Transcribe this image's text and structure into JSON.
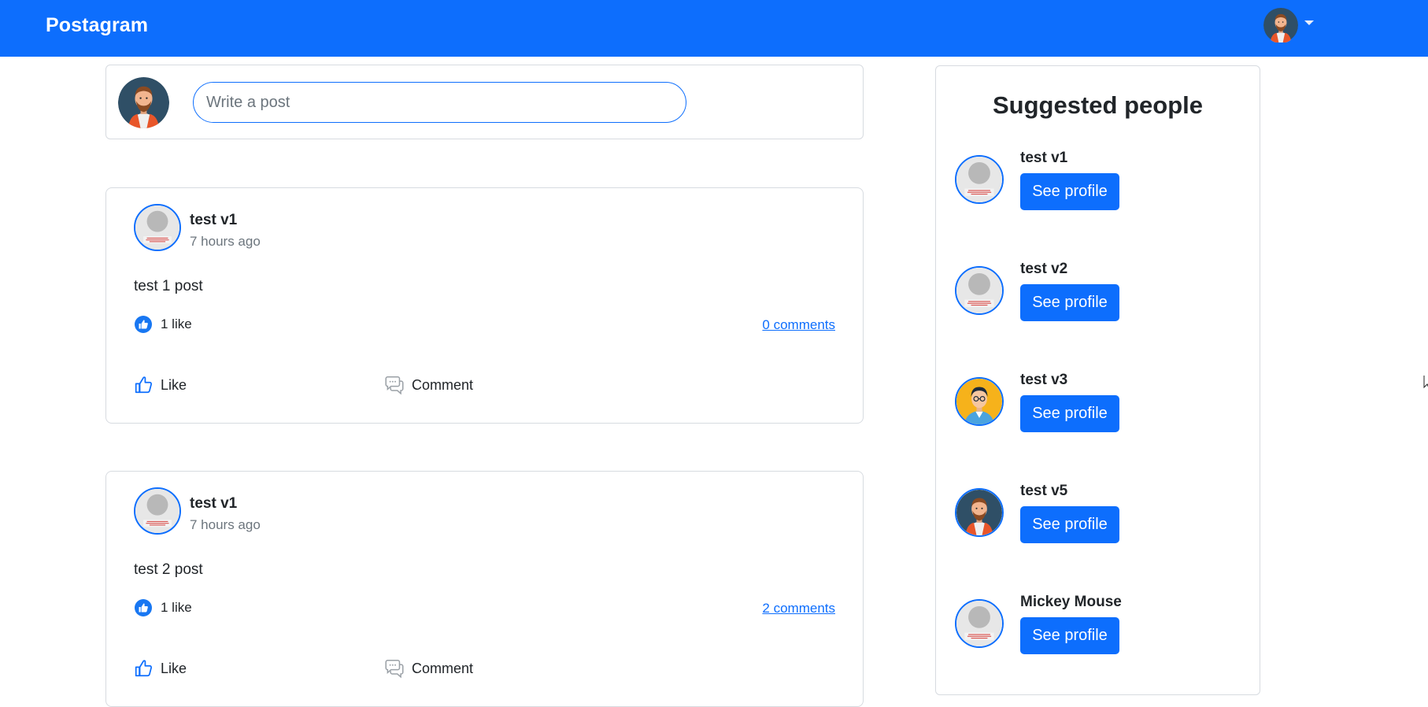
{
  "navbar": {
    "brand": "Postagram"
  },
  "composer": {
    "placeholder": "Write a post"
  },
  "posts": [
    {
      "author": "test v1",
      "time": "7 hours ago",
      "body": "test 1 post",
      "likes": "1 like",
      "comments": "0 comments",
      "like_label": "Like",
      "comment_label": "Comment"
    },
    {
      "author": "test v1",
      "time": "7 hours ago",
      "body": "test 2 post",
      "likes": "1 like",
      "comments": "2 comments",
      "like_label": "Like",
      "comment_label": "Comment"
    }
  ],
  "sidebar": {
    "title": "Suggested people",
    "people": [
      {
        "name": "test v1",
        "button": "See profile",
        "avatar": "default-avatar"
      },
      {
        "name": "test v2",
        "button": "See profile",
        "avatar": "default-avatar"
      },
      {
        "name": "test v3",
        "button": "See profile",
        "avatar": "glasses-man-avatar"
      },
      {
        "name": "test v5",
        "button": "See profile",
        "avatar": "bearded-man-avatar"
      },
      {
        "name": "Mickey Mouse",
        "button": "See profile",
        "avatar": "default-avatar"
      }
    ]
  },
  "colors": {
    "primary": "#0d6efd",
    "muted": "#6c757d",
    "border": "#d7dbe0"
  }
}
